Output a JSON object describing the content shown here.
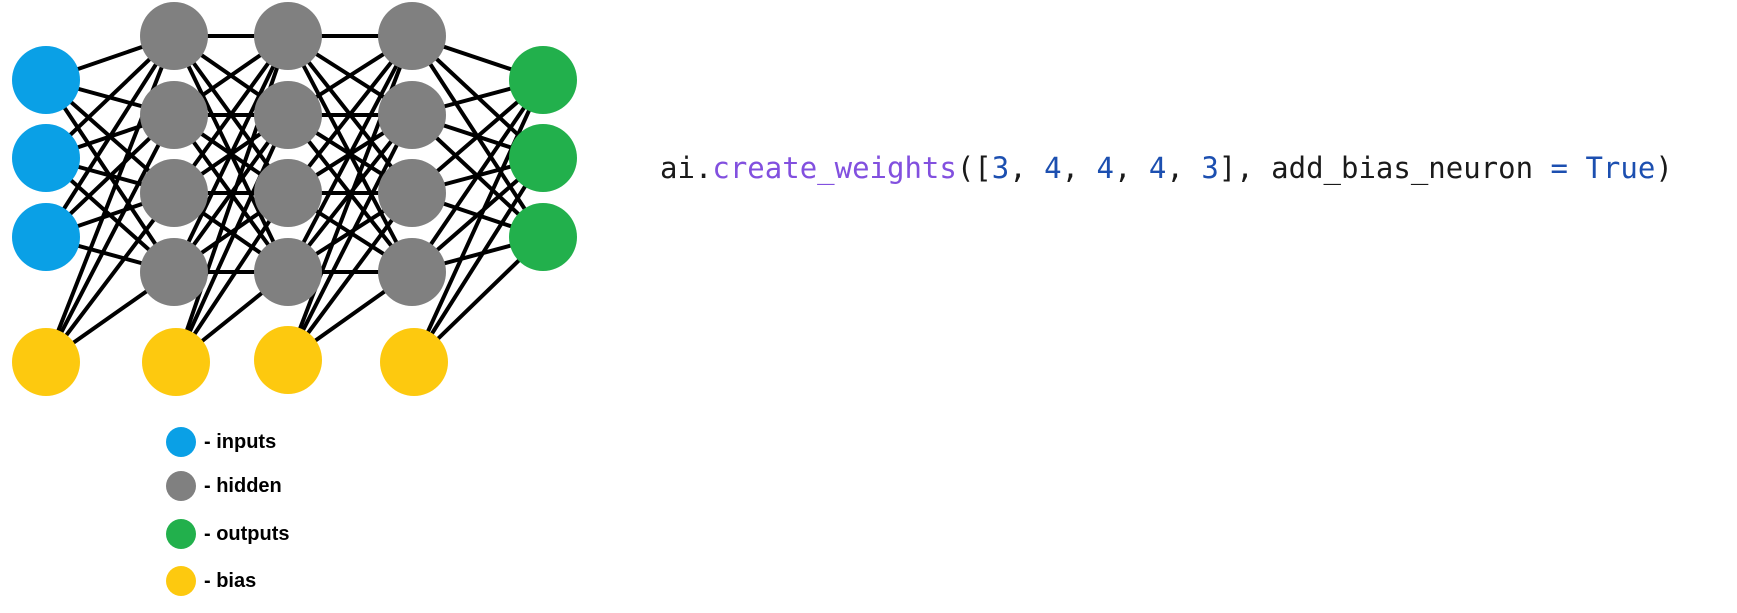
{
  "network": {
    "layers": [
      3,
      4,
      4,
      4,
      3
    ],
    "bias_neurons": 4,
    "colors": {
      "inputs": "#0aa0e6",
      "hidden": "#808080",
      "outputs": "#22b04c",
      "bias": "#fdc90f",
      "edges": "#000000"
    }
  },
  "legend": {
    "items": [
      {
        "label": "- inputs",
        "color_key": "inputs"
      },
      {
        "label": "- hidden",
        "color_key": "hidden"
      },
      {
        "label": "- outputs",
        "color_key": "outputs"
      },
      {
        "label": "- bias",
        "color_key": "bias"
      }
    ]
  },
  "code": {
    "object": "ai",
    "dot": ".",
    "function": "create_weights",
    "open": "([",
    "arg_values": [
      "3",
      "4",
      "4",
      "4",
      "3"
    ],
    "separator": ", ",
    "close_list": "], ",
    "kwarg_name": "add_bias_neuron",
    "equals": " = ",
    "kwarg_value": "True",
    "close": ")"
  }
}
